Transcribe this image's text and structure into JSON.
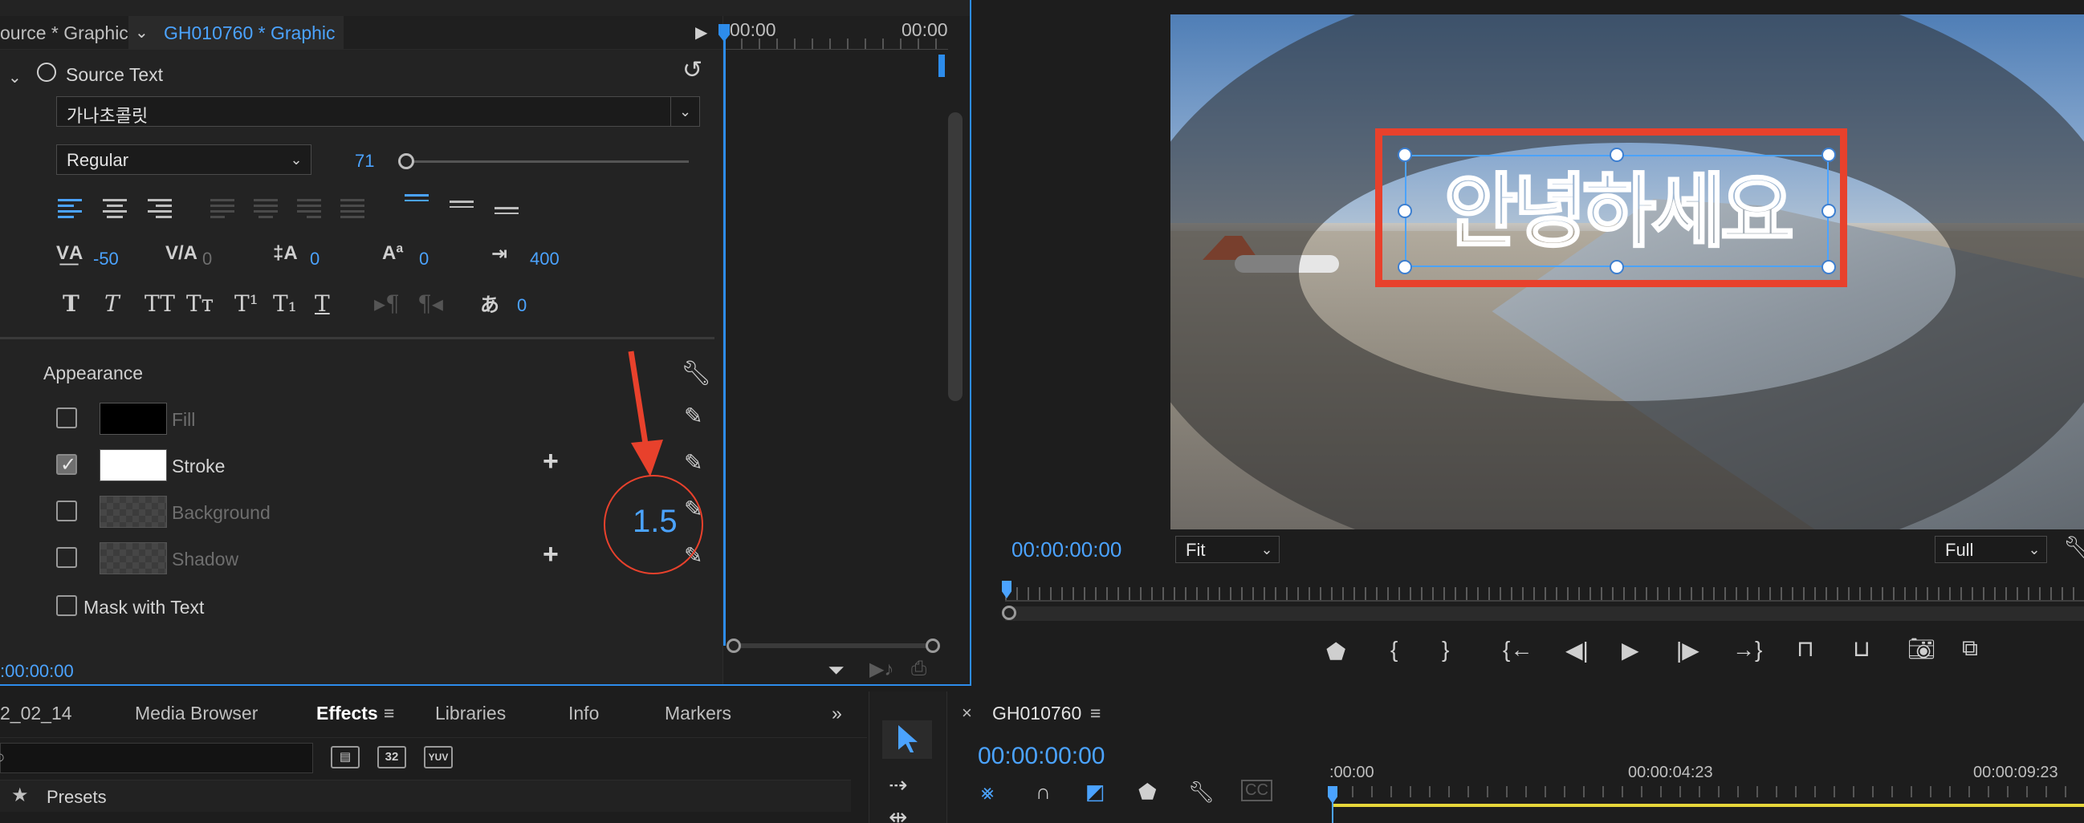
{
  "effect_controls": {
    "tabs": {
      "source": "ource * Graphic",
      "active": "GH010760 * Graphic"
    },
    "timeline_times": {
      "start": "00:00",
      "end": "00:00"
    },
    "source_text": {
      "label": "Source Text",
      "font": "가나초콜릿",
      "style": "Regular",
      "size": "71",
      "tracking": "-50",
      "kerning": "0",
      "leading": "0",
      "baseline_shift": "0",
      "tab_width": "400",
      "tsume": "0"
    },
    "appearance": {
      "label": "Appearance",
      "fill": {
        "label": "Fill",
        "checked": false,
        "color": "#000000"
      },
      "stroke": {
        "label": "Stroke",
        "checked": true,
        "color": "#FFFFFF",
        "width": "1.5"
      },
      "background": {
        "label": "Background",
        "checked": false
      },
      "shadow": {
        "label": "Shadow",
        "checked": false
      },
      "mask_label": "Mask with Text"
    },
    "timecode": ":00:00:00"
  },
  "program_monitor": {
    "timecode": "00:00:00:00",
    "zoom": "Fit",
    "resolution": "Full",
    "overlay_text": "안녕하세요"
  },
  "bottom_panel": {
    "tabs": [
      "2_02_14",
      "Media Browser",
      "Effects",
      "Libraries",
      "Info",
      "Markers"
    ],
    "active_tab": "Effects",
    "chips": [
      "32",
      "YUV"
    ],
    "presets_label": "Presets"
  },
  "sequence": {
    "name": "GH010760",
    "timecode": "00:00:00:00",
    "ruler": [
      ":00:00",
      "00:00:04:23",
      "00:00:09:23"
    ]
  },
  "colors": {
    "accent": "#4BA3FF",
    "annotation": "#E8412C"
  }
}
